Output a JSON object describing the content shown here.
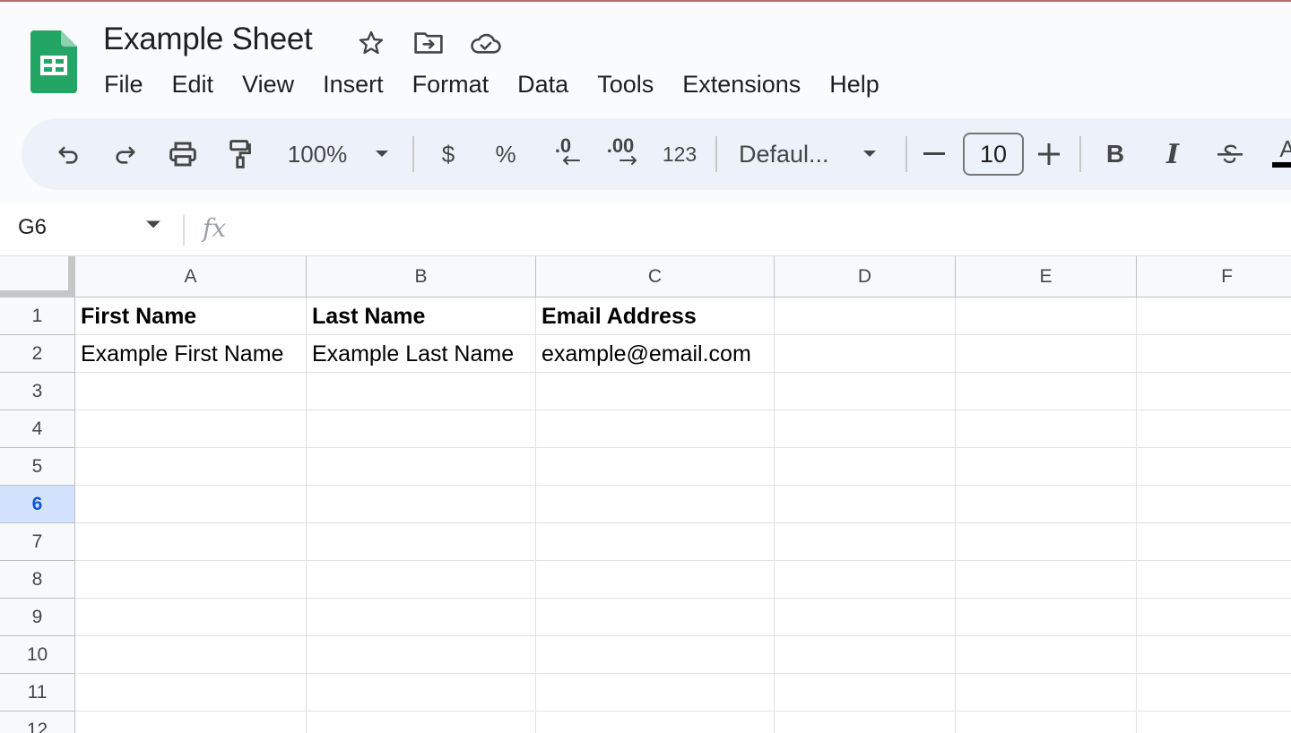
{
  "document": {
    "title": "Example Sheet"
  },
  "menu": [
    "File",
    "Edit",
    "View",
    "Insert",
    "Format",
    "Data",
    "Tools",
    "Extensions",
    "Help"
  ],
  "toolbar": {
    "zoom": "100%",
    "currency": "$",
    "percent": "%",
    "decrease_decimal": ".0",
    "increase_decimal": ".00",
    "number_format": "123",
    "font": "Defaul...",
    "font_size": "10",
    "bold": "B",
    "italic": "I",
    "text_color_letter": "A"
  },
  "formula_bar": {
    "cell_ref": "G6",
    "fx": "fx",
    "content": ""
  },
  "columns": [
    "A",
    "B",
    "C",
    "D",
    "E",
    "F"
  ],
  "rows": [
    "1",
    "2",
    "3",
    "4",
    "5",
    "6",
    "7",
    "8",
    "9",
    "10",
    "11",
    "12"
  ],
  "selected_row": "6",
  "cells": {
    "A1": "First Name",
    "B1": "Last Name",
    "C1": "Email Address",
    "A2": "Example First Name",
    "B2": "Example Last Name",
    "C2": "example@email.com"
  },
  "colors": {
    "sheets_green": "#23a566",
    "selected_row_bg": "#d3e3fd",
    "selected_row_text": "#0b57d0"
  }
}
